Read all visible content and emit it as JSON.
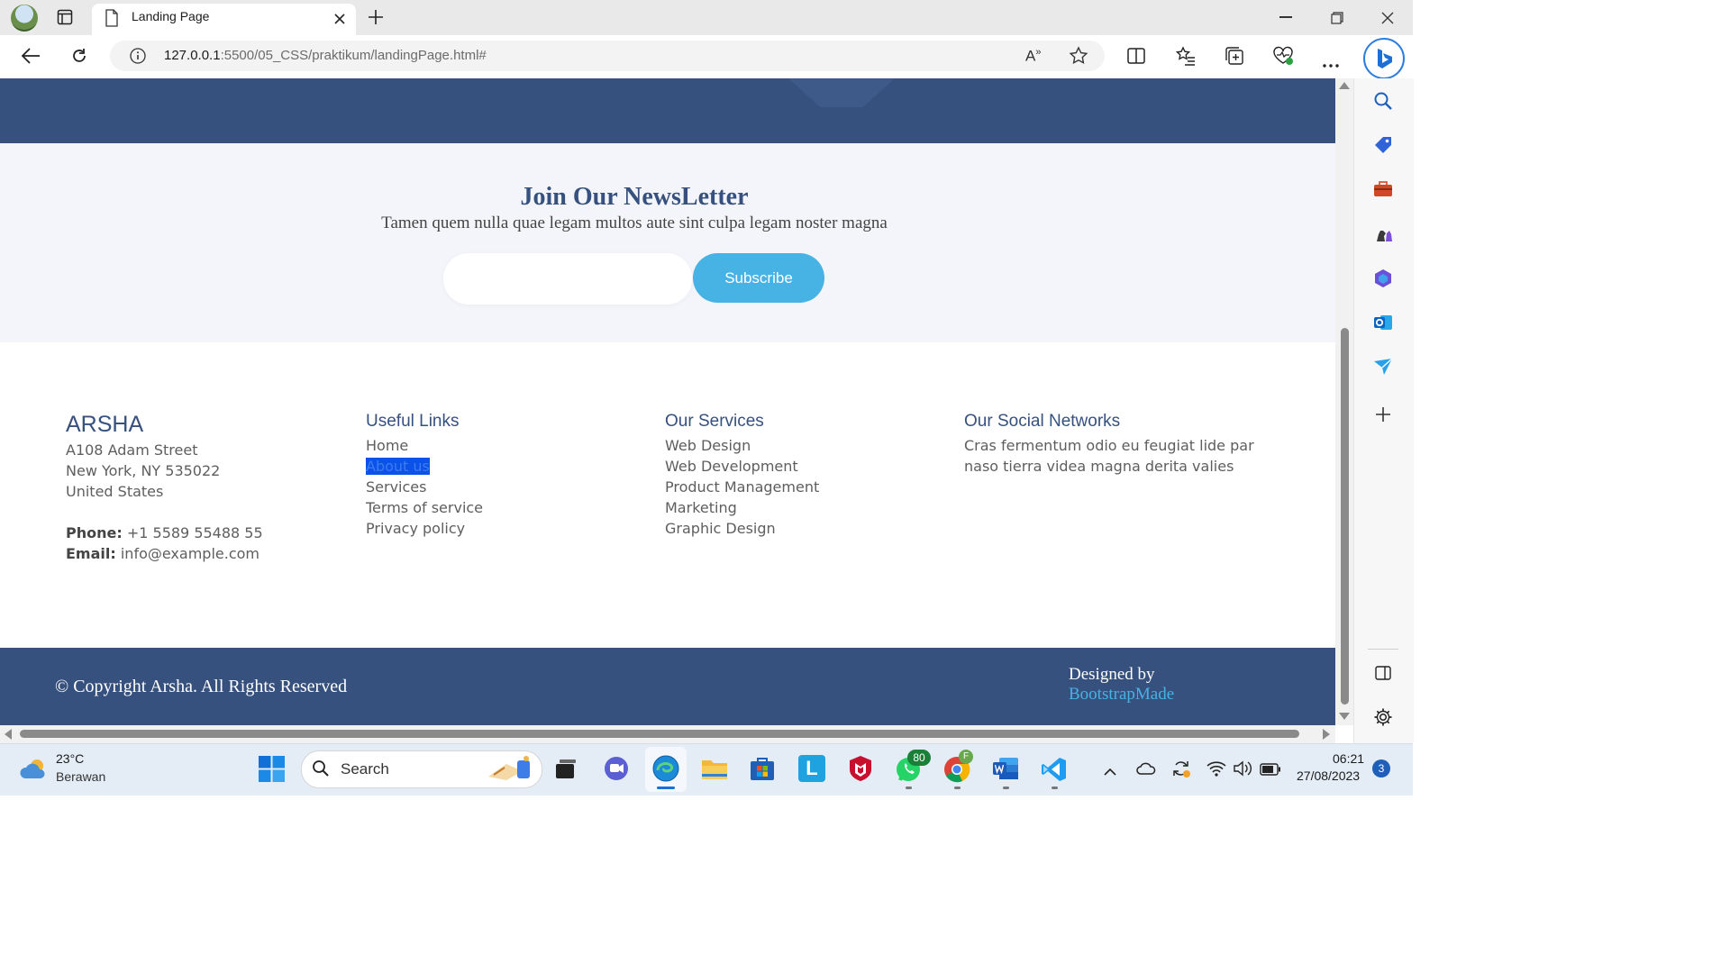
{
  "browser": {
    "tab_title": "Landing Page",
    "url_host": "127.0.0.1",
    "url_path": ":5500/05_CSS/praktikum/landingPage.html#"
  },
  "newsletter": {
    "title": "Join Our NewsLetter",
    "subtitle": "Tamen quem nulla quae legam multos aute sint culpa legam noster magna",
    "email_value": "",
    "subscribe_label": "Subscribe",
    "accent_color": "#47b2e4"
  },
  "footer": {
    "brand": "ARSHA",
    "address": [
      "A108 Adam Street",
      "New York, NY 535022",
      "United States"
    ],
    "phone_label": "Phone:",
    "phone": "+1 5589 55488 55",
    "email_label": "Email:",
    "email": "info@example.com",
    "useful_links_title": "Useful Links",
    "useful_links": [
      "Home",
      "About us",
      "Services",
      "Terms of service",
      "Privacy policy"
    ],
    "services_title": "Our Services",
    "services": [
      "Web Design",
      "Web Development",
      "Product Management",
      "Marketing",
      "Graphic Design"
    ],
    "social_title": "Our Social Networks",
    "social_text_1": "Cras fermentum odio eu feugiat lide par",
    "social_text_2": "naso tierra videa magna derita valies",
    "copyright": "© Copyright Arsha. All Rights Reserved",
    "designed_by": "Designed by",
    "designed_link": "BootstrapMade",
    "brand_color": "#37517e"
  },
  "taskbar": {
    "weather_temp": "23°C",
    "weather_desc": "Berawan",
    "search_placeholder": "Search",
    "whatsapp_badge": "80",
    "chrome_badge": "F",
    "time": "06:21",
    "date": "27/08/2023",
    "notification_count": "3"
  }
}
